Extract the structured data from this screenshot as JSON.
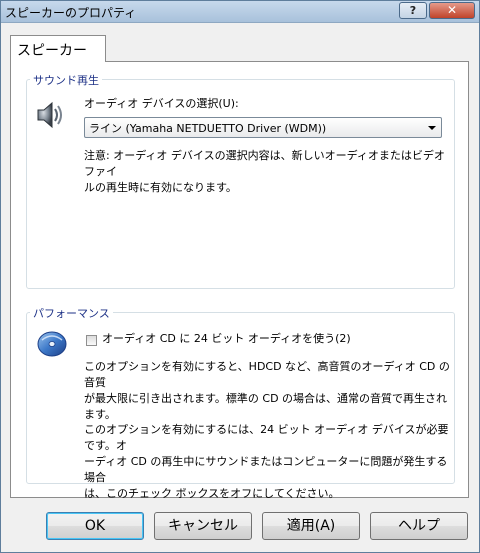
{
  "window": {
    "title": "スピーカーのプロパティ",
    "help_glyph": "?",
    "close_glyph": "✕"
  },
  "tabs": [
    {
      "label": "スピーカー",
      "selected": true
    }
  ],
  "sound_playback": {
    "title": "サウンド再生",
    "icon": "speaker-icon",
    "select_label": "オーディオ デバイスの選択(U):",
    "select_value": "ライン (Yamaha NETDUETTO Driver (WDM))",
    "note_line1": "注意: オーディオ デバイスの選択内容は、新しいオーディオまたはビデオ ファイ",
    "note_line2": "ルの再生時に有効になります。"
  },
  "performance": {
    "title": "パフォーマンス",
    "icon": "cd-icon",
    "checkbox_label": "オーディオ CD に 24 ビット オーディオを使う(2)",
    "checkbox_checked": false,
    "desc1_line1": "このオプションを有効にすると、HDCD など、高音質のオーディオ CD の音質",
    "desc1_line2": "が最大限に引き出されます。標準の CD の場合は、通常の音質で再生され",
    "desc1_line3": "ます。",
    "desc2_line1": "このオプションを有効にするには、24 ビット オーディオ デバイスが必要です。オ",
    "desc2_line2": "ーディオ CD の再生中にサウンドまたはコンピューターに問題が発生する場合",
    "desc2_line3": "は、このチェック ボックスをオフにしてください。"
  },
  "buttons": {
    "ok": "OK",
    "cancel": "キャンセル",
    "apply": "適用(A)",
    "help": "ヘルプ"
  },
  "colors": {
    "group_title": "#1e3287",
    "default_button_focus": "#48c6f6"
  }
}
